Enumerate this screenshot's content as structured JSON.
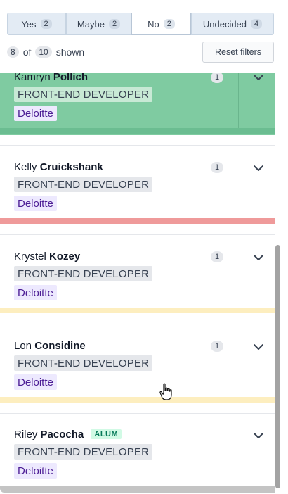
{
  "filters": [
    {
      "label": "Yes",
      "count": "2"
    },
    {
      "label": "Maybe",
      "count": "2"
    },
    {
      "label": "No",
      "count": "2"
    },
    {
      "label": "Undecided",
      "count": "4"
    }
  ],
  "summary": {
    "shown": "8",
    "of": "of",
    "total": "10",
    "suffix": "shown"
  },
  "reset_label": "Reset filters",
  "candidates": [
    {
      "first": "Kamryn",
      "last": "Pollich",
      "count": "1",
      "role": "FRONT-END DEVELOPER",
      "company": "Deloitte",
      "status_color": "#7fcba1"
    },
    {
      "first": "Kelly",
      "last": "Cruickshank",
      "count": "1",
      "role": "FRONT-END DEVELOPER",
      "company": "Deloitte",
      "status_color": "#ef9a9a"
    },
    {
      "first": "Krystel",
      "last": "Kozey",
      "count": "1",
      "role": "FRONT-END DEVELOPER",
      "company": "Deloitte",
      "status_color": "#fdeebf"
    },
    {
      "first": "Lon",
      "last": "Considine",
      "count": "1",
      "role": "FRONT-END DEVELOPER",
      "company": "Deloitte",
      "status_color": "#fdeebf"
    },
    {
      "first": "Riley",
      "last": "Pacocha",
      "badge": "ALUM",
      "role": "FRONT-END DEVELOPER",
      "company": "Deloitte"
    }
  ],
  "icons": {
    "expand": "chevron-down-icon",
    "pointer": "hand-pointer-icon"
  }
}
